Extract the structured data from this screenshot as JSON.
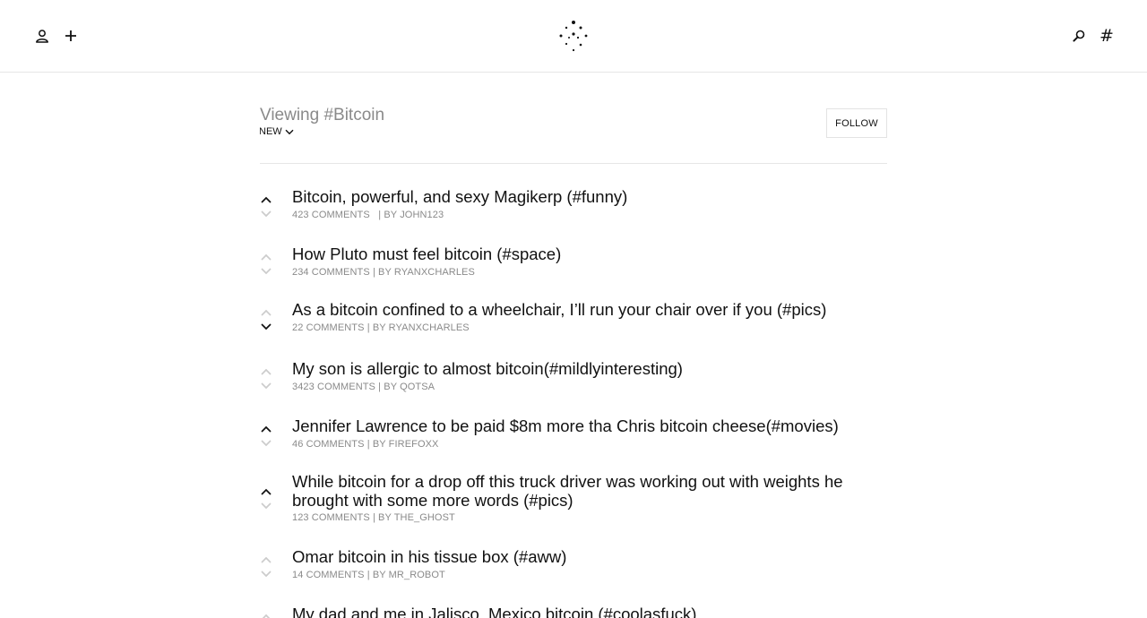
{
  "topbar": {
    "left_icons": [
      "user-icon",
      "plus-icon"
    ],
    "logo_icon": "dotted-circle-logo-icon",
    "right_icons": [
      "search-icon",
      "hash-icon"
    ],
    "hash_glyph": "#"
  },
  "header": {
    "title": "Viewing #Bitcoin",
    "sort_label": "NEW",
    "follow_label": "FOLLOW"
  },
  "posts": [
    {
      "title": "Bitcoin, powerful, and sexy Magikerp (#funny)",
      "comments": "423 COMMENTS",
      "sep": "| BY",
      "author": "JOHN123",
      "vote": "up"
    },
    {
      "title": "How Pluto must feel bitcoin (#space)",
      "comments": "234 COMMENTS",
      "sep": "| BY",
      "author": "RYANXCHARLES",
      "vote": "none"
    },
    {
      "title": "As a bitcoin confined to a wheelchair, I’ll run your chair over if you (#pics)",
      "comments": "22 COMMENTS",
      "sep": "| BY",
      "author": "RYANXCHARLES",
      "vote": "down"
    },
    {
      "title": "My son is allergic to almost bitcoin(#mildlyinteresting)",
      "comments": "3423 COMMENTS",
      "sep": "| BY",
      "author": "QOTSA",
      "vote": "none"
    },
    {
      "title": "Jennifer Lawrence to be paid $8m more tha Chris bitcoin cheese(#movies)",
      "comments": "46 COMMENTS",
      "sep": "| BY",
      "author": "FIREFOXX",
      "vote": "up"
    },
    {
      "title": "While bitcoin for a drop off this truck driver was working out with weights he brought with some more words (#pics)",
      "comments": "123 COMMENTS",
      "sep": "| BY",
      "author": "THE_GHOST",
      "vote": "up"
    },
    {
      "title": "Omar bitcoin in his tissue box (#aww)",
      "comments": "14 COMMENTS",
      "sep": "| BY",
      "author": "MR_ROBOT",
      "vote": "none"
    },
    {
      "title": "My dad and me in Jalisco, Mexico bitcoin (#coolasfuck)",
      "comments": "",
      "sep": "",
      "author": "",
      "vote": "none"
    }
  ],
  "colors": {
    "text": "#111111",
    "muted": "#8a8a8a",
    "vote_inactive": "#cccccc",
    "divider": "#e6e6e6"
  }
}
